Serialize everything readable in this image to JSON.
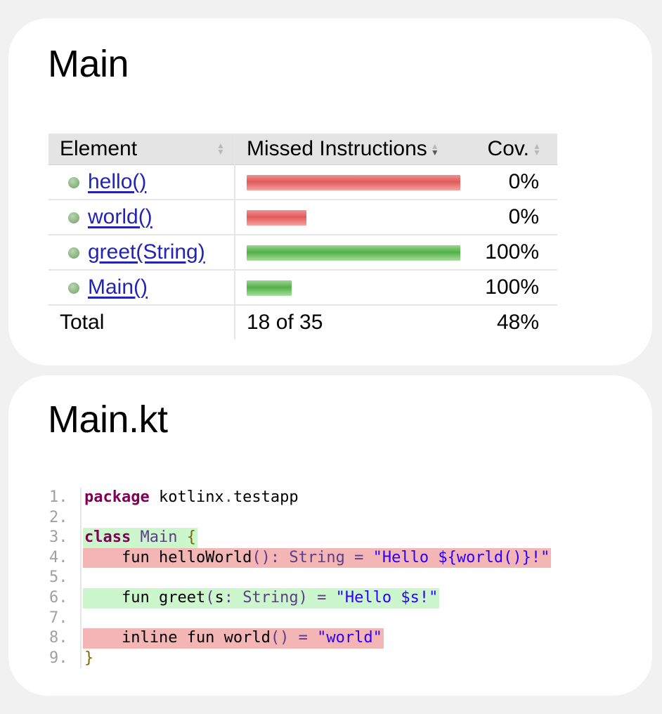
{
  "coverage_report": {
    "title": "Main",
    "columns": {
      "element": "Element",
      "missed_instructions": "Missed Instructions",
      "coverage": "Cov."
    },
    "rows": [
      {
        "element": "hello()",
        "missed_fraction": 1.0,
        "bar_status": "missed",
        "coverage": "0%"
      },
      {
        "element": "world()",
        "missed_fraction": 0.28,
        "bar_status": "missed",
        "coverage": "0%"
      },
      {
        "element": "greet(String)",
        "missed_fraction": 1.0,
        "bar_status": "covered",
        "coverage": "100%"
      },
      {
        "element": "Main()",
        "missed_fraction": 0.21,
        "bar_status": "covered",
        "coverage": "100%"
      }
    ],
    "total": {
      "label": "Total",
      "missed": "18 of 35",
      "coverage": "48%"
    },
    "colors": {
      "missed": "#e25a5a",
      "covered": "#52b047",
      "link": "#2323b8",
      "header_bg": "#e4e4e4"
    }
  },
  "source_file": {
    "title": "Main.kt",
    "lines": [
      {
        "num": "1.",
        "status": "none",
        "tokens": [
          {
            "t": "package",
            "c": "kw"
          },
          {
            "t": " kotlinx",
            "c": "plain"
          },
          {
            "t": ".",
            "c": "op"
          },
          {
            "t": "testapp",
            "c": "plain"
          }
        ]
      },
      {
        "num": "2.",
        "status": "none",
        "tokens": []
      },
      {
        "num": "3.",
        "status": "covered",
        "tokens": [
          {
            "t": "class",
            "c": "kw"
          },
          {
            "t": " ",
            "c": "plain"
          },
          {
            "t": "Main",
            "c": "ty"
          },
          {
            "t": " {",
            "c": "br"
          }
        ]
      },
      {
        "num": "4.",
        "status": "missed",
        "tokens": [
          {
            "t": "    fun helloWorld",
            "c": "plain"
          },
          {
            "t": "():",
            "c": "op"
          },
          {
            "t": " ",
            "c": "plain"
          },
          {
            "t": "String",
            "c": "ty"
          },
          {
            "t": " = ",
            "c": "op"
          },
          {
            "t": "\"Hello ${world()}!\"",
            "c": "str"
          }
        ]
      },
      {
        "num": "5.",
        "status": "none",
        "tokens": []
      },
      {
        "num": "6.",
        "status": "covered",
        "tokens": [
          {
            "t": "    fun greet",
            "c": "plain"
          },
          {
            "t": "(",
            "c": "op"
          },
          {
            "t": "s",
            "c": "plain"
          },
          {
            "t": ": ",
            "c": "op"
          },
          {
            "t": "String",
            "c": "ty"
          },
          {
            "t": ") = ",
            "c": "op"
          },
          {
            "t": "\"Hello $s!\"",
            "c": "str"
          }
        ]
      },
      {
        "num": "7.",
        "status": "none",
        "tokens": []
      },
      {
        "num": "8.",
        "status": "missed",
        "tokens": [
          {
            "t": "    inline fun world",
            "c": "plain"
          },
          {
            "t": "() = ",
            "c": "op"
          },
          {
            "t": "\"world\"",
            "c": "str"
          }
        ]
      },
      {
        "num": "9.",
        "status": "none",
        "tokens": [
          {
            "t": "}",
            "c": "br"
          }
        ]
      }
    ]
  }
}
